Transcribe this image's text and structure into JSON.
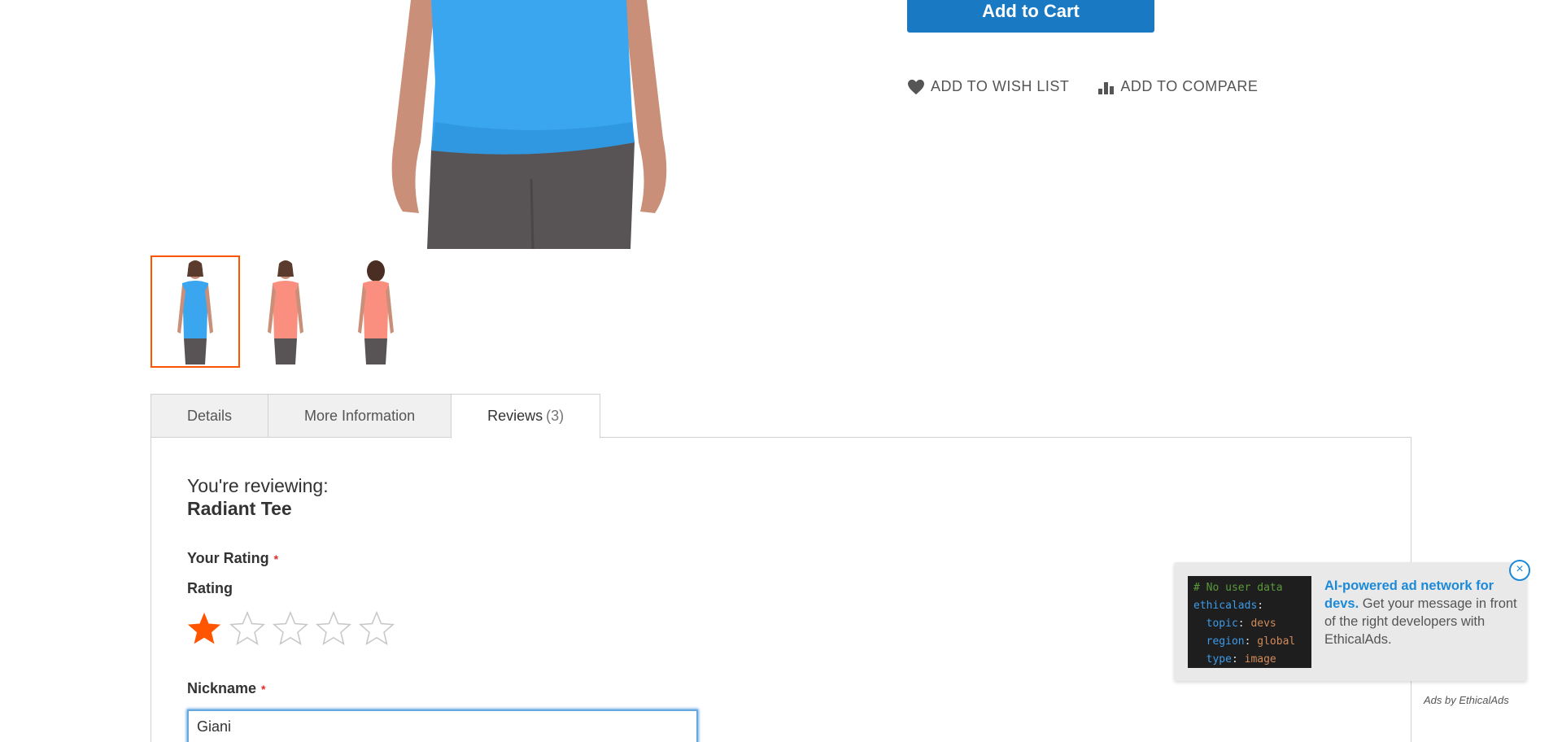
{
  "product": {
    "add_to_cart_label": "Add to Cart",
    "wishlist_label": "ADD TO WISH LIST",
    "compare_label": "ADD TO COMPARE",
    "thumbnails": [
      "blue front",
      "pink front",
      "pink back"
    ]
  },
  "tabs": [
    {
      "label": "Details"
    },
    {
      "label": "More Information"
    },
    {
      "label": "Reviews",
      "count": "(3)",
      "active": true
    }
  ],
  "review_form": {
    "reviewing_label": "You're reviewing:",
    "product_name": "Radiant Tee",
    "your_rating_label": "Your Rating",
    "required_mark": "*",
    "rating_label": "Rating",
    "rating_value": 1,
    "rating_max": 5,
    "nickname_label": "Nickname",
    "nickname_value": "Giani"
  },
  "ad": {
    "code_lines": [
      "# No user data",
      "ethicalads:",
      "  topic: devs",
      "  region: global",
      "  type: image"
    ],
    "headline": "AI-powered ad network for devs.",
    "body": " Get your message in front of the right developers with EthicalAds.",
    "close_label": "×",
    "attribution": "Ads by EthicalAds"
  },
  "colors": {
    "primary_button": "#1979c3",
    "star_active": "#ff5501",
    "thumb_active_border": "#ff5501",
    "required": "#e02b27",
    "ad_link": "#1c8ad8"
  }
}
